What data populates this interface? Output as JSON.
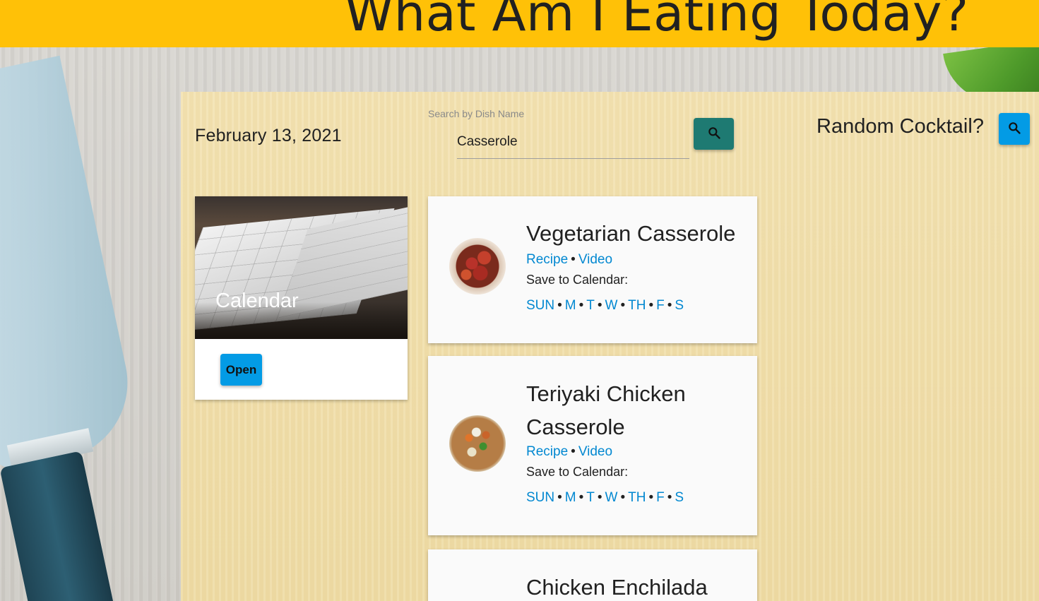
{
  "header": {
    "title": "What Am I Eating Today?"
  },
  "date": "February 13, 2021",
  "search": {
    "label": "Search by Dish Name",
    "value": "Casserole",
    "button_icon": "search-icon"
  },
  "cocktail": {
    "label": "Random Cocktail?",
    "button_icon": "search-icon"
  },
  "calendar_card": {
    "title": "Calendar",
    "open_label": "Open"
  },
  "recipes": [
    {
      "name": "Vegetarian Casserole",
      "recipe_link": "Recipe",
      "video_link": "Video",
      "save_label": "Save to Calendar:",
      "days": [
        "SUN",
        "M",
        "T",
        "W",
        "TH",
        "F",
        "S"
      ]
    },
    {
      "name": "Teriyaki Chicken Casserole",
      "recipe_link": "Recipe",
      "video_link": "Video",
      "save_label": "Save to Calendar:",
      "days": [
        "SUN",
        "M",
        "T",
        "W",
        "TH",
        "F",
        "S"
      ]
    },
    {
      "name": "Chicken Enchilada"
    }
  ],
  "separator": "•",
  "colors": {
    "header": "#ffc107",
    "search_button": "#1e7a72",
    "accent_button": "#039be5",
    "link": "#0288d1"
  }
}
